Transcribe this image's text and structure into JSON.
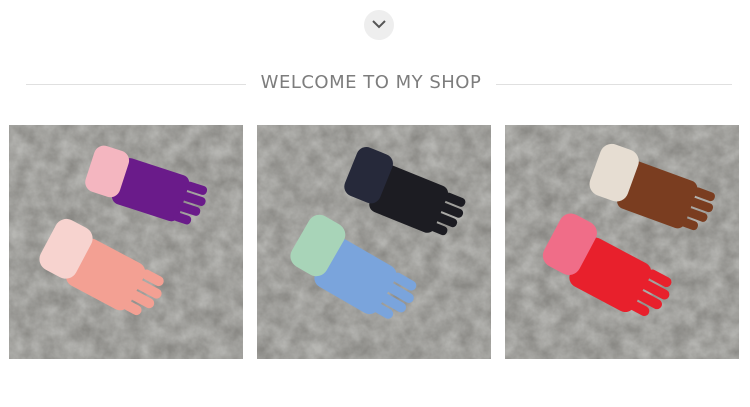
{
  "scroll_button": {
    "icon": "chevron-down-icon",
    "color": "#555555"
  },
  "heading": {
    "text": "WELCOME TO MY SHOP",
    "color": "#7d7d7d"
  },
  "products": [
    {
      "name": "purple-and-pink-gloves",
      "glove_colors": [
        "#6a1b8a",
        "#f3a093"
      ]
    },
    {
      "name": "black-and-blue-gloves",
      "glove_colors": [
        "#1c1c22",
        "#7aa4dc"
      ]
    },
    {
      "name": "brown-and-red-gloves",
      "glove_colors": [
        "#7a3d20",
        "#e8202c"
      ]
    }
  ]
}
